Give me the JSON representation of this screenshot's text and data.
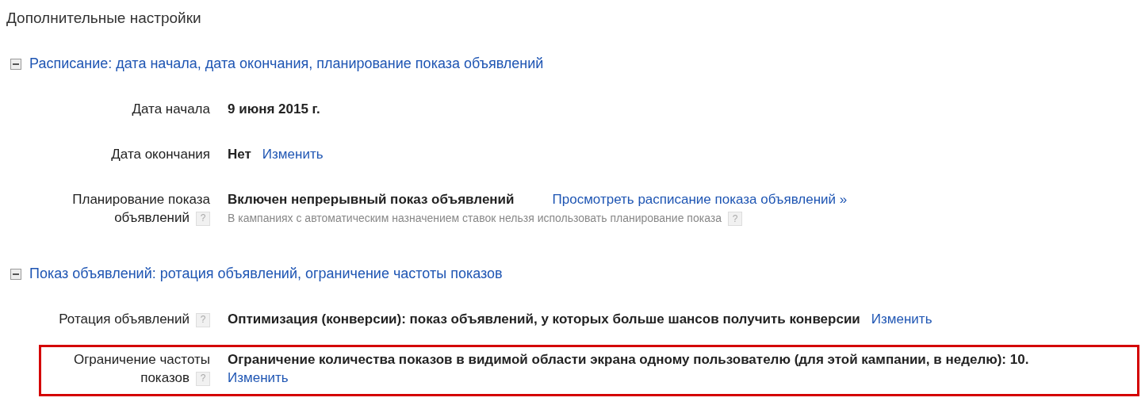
{
  "title": "Дополнительные настройки",
  "sections": [
    {
      "header": "Расписание: дата начала, дата окончания, планирование показа объявлений",
      "expanded": true,
      "rows": [
        {
          "label": "Дата начала",
          "highlighted": false,
          "value": "9 июня 2015 г."
        },
        {
          "label": "Дата окончания",
          "highlighted": false,
          "value": "Нет",
          "link": "Изменить"
        },
        {
          "label": "Планирование показа объявлений",
          "help_mark": "?",
          "highlighted": false,
          "value": "Включен непрерывный показ объявлений",
          "link": "Просмотреть расписание показа объявлений »",
          "note": "В кампаниях с автоматическим назначением ставок нельзя использовать планирование показа",
          "note_help_mark": "?"
        }
      ]
    },
    {
      "header": "Показ объявлений: ротация объявлений, ограничение частоты показов",
      "expanded": true,
      "rows": [
        {
          "label": "Ротация объявлений",
          "help_mark": "?",
          "highlighted": false,
          "value": "Оптимизация (конверсии): показ объявлений, у которых больше шансов получить конверсии",
          "link": "Изменить"
        },
        {
          "label": "Ограничение частоты показов",
          "help_mark": "?",
          "highlighted": true,
          "value": "Ограничение количества показов в видимой области экрана одному пользователю (для этой кампании, в неделю): 10.",
          "link": "Изменить"
        }
      ]
    }
  ]
}
